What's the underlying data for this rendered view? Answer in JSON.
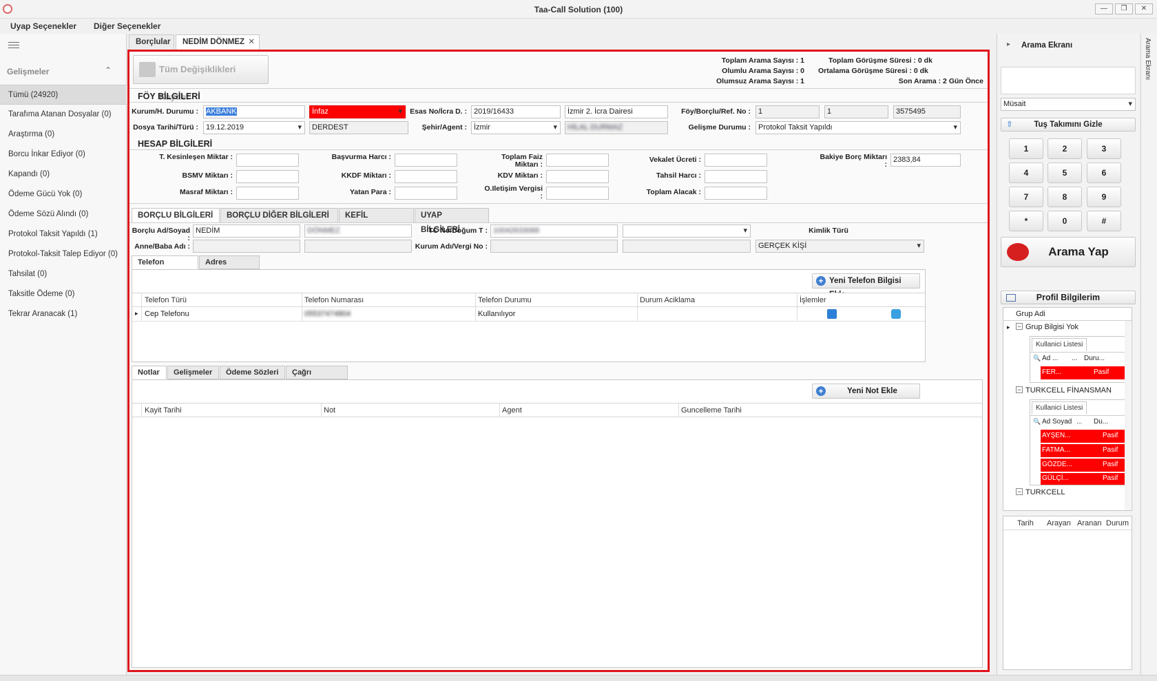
{
  "window": {
    "title": "Taa-Call Solution (100)",
    "min": "—",
    "max": "❐",
    "close": "✕"
  },
  "menu": {
    "items": [
      "Uyap Seçenekler",
      "Diğer Seçenekler"
    ]
  },
  "left": {
    "header": "Gelişmeler",
    "collapse": "⌃",
    "items": [
      "Tümü (24920)",
      "Tarafıma Atanan Dosyalar (0)",
      "Araştırma (0)",
      "Borcu İnkar Ediyor (0)",
      "Kapandı (0)",
      "Ödeme Gücü Yok (0)",
      "Ödeme Sözü Alındı (0)",
      "Protokol Taksit Yapıldı (1)",
      "Protokol-Taksit Talep Ediyor (0)",
      "Tahsilat (0)",
      "Taksitle Ödeme (0)",
      "Tekrar Aranacak (1)"
    ]
  },
  "doctabs": {
    "t1": "Borçlular",
    "t2": "NEDİM DÖNMEZ",
    "close": "✕"
  },
  "save": {
    "label": "Tüm Değişiklikleri Kaydet"
  },
  "stats": {
    "a": "Toplam Arama Sayısı : 1",
    "b": "Olumlu Arama Sayısı : 0",
    "c": "Olumsuz Arama Sayısı : 1",
    "d": "Toplam Görüşme Süresi : 0 dk",
    "e": "Ortalama Görüşme Süresi : 0 dk",
    "f": "Son Arama : 2 Gün Önce"
  },
  "foy": {
    "title": "FÖY BİLGİLERİ",
    "l1": "Kurum/H. Durumu :",
    "v_kurum": "AKBANK",
    "v_durum": "İnfaz",
    "l2": "Esas No/İcra D. :",
    "v_esas": "2019/16433",
    "v_icra": "İzmir 2. İcra Dairesi",
    "l3": "Föy/Borçlu/Ref. No :",
    "v_r1": "1",
    "v_r2": "1",
    "v_r3": "3575495",
    "l4": "Dosya Tarihi/Türü :",
    "v_tarih": "19.12.2019",
    "v_tur": "DERDEST",
    "l5": "Şehir/Agent :",
    "v_sehir": "İzmir",
    "v_agent": "HİLAL DURMAZ",
    "l6": "Gelişme Durumu :",
    "v_gelisme": "Protokol Taksit Yapıldı"
  },
  "hesap": {
    "title": "HESAP BİLGİLERİ",
    "tk": "T. Kesinleşen Miktar :",
    "bsmv": "BSMV Miktarı :",
    "masraf": "Masraf Miktarı :",
    "basvurma": "Başvurma Harcı :",
    "kkdf": "KKDF Miktarı :",
    "yatan": "Yatan Para :",
    "faiz": "Toplam Faiz Miktarı :",
    "kdv": "KDV Miktarı :",
    "oil": "O.Iletişim Vergisi :",
    "vekalet": "Vekalet Ücreti :",
    "tahsil": "Tahsil Harcı :",
    "alacak": "Toplam Alacak :",
    "bakiye": "Bakiye Borç Miktarı :",
    "v_bakiye": "2383,84"
  },
  "btabs": [
    "BORÇLU BİLGİLERİ",
    "BORÇLU DİĞER BİLGİLERİ",
    "KEFİL BİLGİLERİ",
    "UYAP BİLGİLERİ"
  ],
  "borclu": {
    "l_ad": "Borçlu Ad/Soyad :",
    "v_ad": "NEDİM",
    "v_soyad": "DÖNMEZ",
    "l_tc": "TC No/Doğum T :",
    "v_tc": "10042633066",
    "l_kimlik": "Kimlik Türü",
    "l_anne": "Anne/Baba Adı :",
    "l_kurum": "Kurum Adı/Vergi No :",
    "v_kisi": "GERÇEK KİŞİ"
  },
  "ttabs": [
    "Telefon Bilgileri",
    "Adres Bilgileri"
  ],
  "phone": {
    "add": "Yeni Telefon Bilgisi Ekle",
    "cols": [
      "Telefon Türü",
      "Telefon Numarası",
      "Telefon Durumu",
      "Durum Aciklama",
      "İşlemler"
    ],
    "row": {
      "tur": "Cep Telefonu",
      "no": "05537474804",
      "durum": "Kullanılıyor"
    }
  },
  "ntabs": [
    "Notlar",
    "Gelişmeler",
    "Ödeme Sözleri",
    "Çağrı Kayıtları"
  ],
  "notes": {
    "add": "Yeni Not Ekle",
    "cols": [
      "Kayit Tarihi",
      "Not",
      "Agent",
      "Guncelleme Tarihi"
    ]
  },
  "right": {
    "title": "Arama Ekranı",
    "status": "Müsait",
    "hide": "Tuş Takımını Gizle",
    "keys": [
      "1",
      "2",
      "3",
      "4",
      "5",
      "6",
      "7",
      "8",
      "9",
      "*",
      "0",
      "#"
    ],
    "call": "Arama Yap",
    "profile": "Profil Bilgilerim",
    "grp_col": "Grup Adi",
    "g1": "Grup Bilgisi Yok",
    "ulist": "Kullanici Listesi",
    "c_ad": "Ad ...",
    "c_dots": "...",
    "c_dur": "Duru...",
    "c_adsoyad": "Ad Soyad",
    "c_du": "Du...",
    "u1": "FER...",
    "pasif": "Pasif",
    "g2": "TURKCELL FİNANSMAN",
    "u2": "AYŞEN...",
    "u3": "FATMA...",
    "u4": "GÖZDE...",
    "u5": "GÜLÇİ...",
    "g3": "TURKCELL",
    "hist": [
      "Tarih",
      "Arayan",
      "Aranan",
      "Durum"
    ]
  },
  "side": "Arama Ekranı"
}
